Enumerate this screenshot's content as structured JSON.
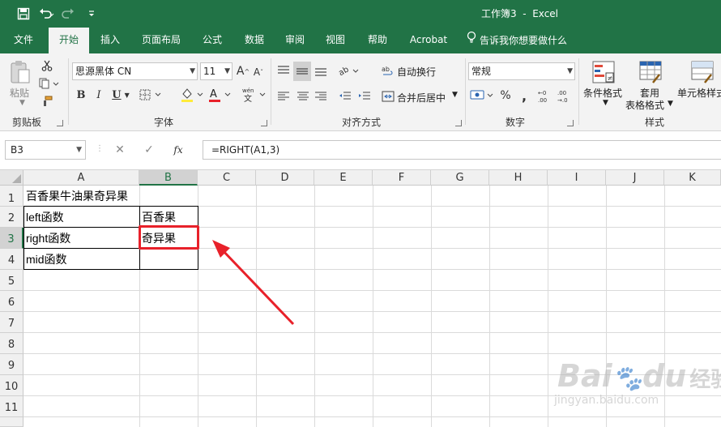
{
  "window": {
    "title": "工作簿3  -  Excel",
    "accent": "#217346"
  },
  "tabs": [
    "文件",
    "开始",
    "插入",
    "页面布局",
    "公式",
    "数据",
    "审阅",
    "视图",
    "帮助",
    "Acrobat"
  ],
  "active_tab": "开始",
  "tell_me": "告诉我你想要做什么",
  "ribbon": {
    "clipboard": {
      "paste": "粘贴",
      "label": "剪贴板"
    },
    "font": {
      "name": "思源黑体 CN",
      "size": "11",
      "label": "字体"
    },
    "alignment": {
      "wrap": "自动换行",
      "merge": "合并后居中",
      "label": "对齐方式"
    },
    "number": {
      "format": "常规",
      "label": "数字"
    },
    "styles": {
      "conditional": "条件格式",
      "table_line1": "套用",
      "table_line2": "表格格式",
      "cell_styles": "单元格样式",
      "label": "样式"
    }
  },
  "formula_bar": {
    "name_box": "B3",
    "fx": "fx",
    "formula": "=RIGHT(A1,3)"
  },
  "columns": [
    "A",
    "B",
    "C",
    "D",
    "E",
    "F",
    "G",
    "H",
    "I",
    "J",
    "K"
  ],
  "rows": [
    "1",
    "2",
    "3",
    "4",
    "5",
    "6",
    "7",
    "8",
    "9",
    "10",
    "11"
  ],
  "selected_cell": {
    "column": "B",
    "row": "3",
    "highlight_color": "#e8212a"
  },
  "cells": {
    "A1": "百香果牛油果奇异果",
    "A2": "left函数",
    "B2": "百香果",
    "A3": "right函数",
    "B3": "奇异果",
    "A4": "mid函数"
  },
  "annotation": {
    "arrow_color": "#e8212a"
  },
  "watermark": {
    "main": "Bai",
    "mid": "du",
    "cn": "经验",
    "url": "jingyan.baidu.com"
  }
}
